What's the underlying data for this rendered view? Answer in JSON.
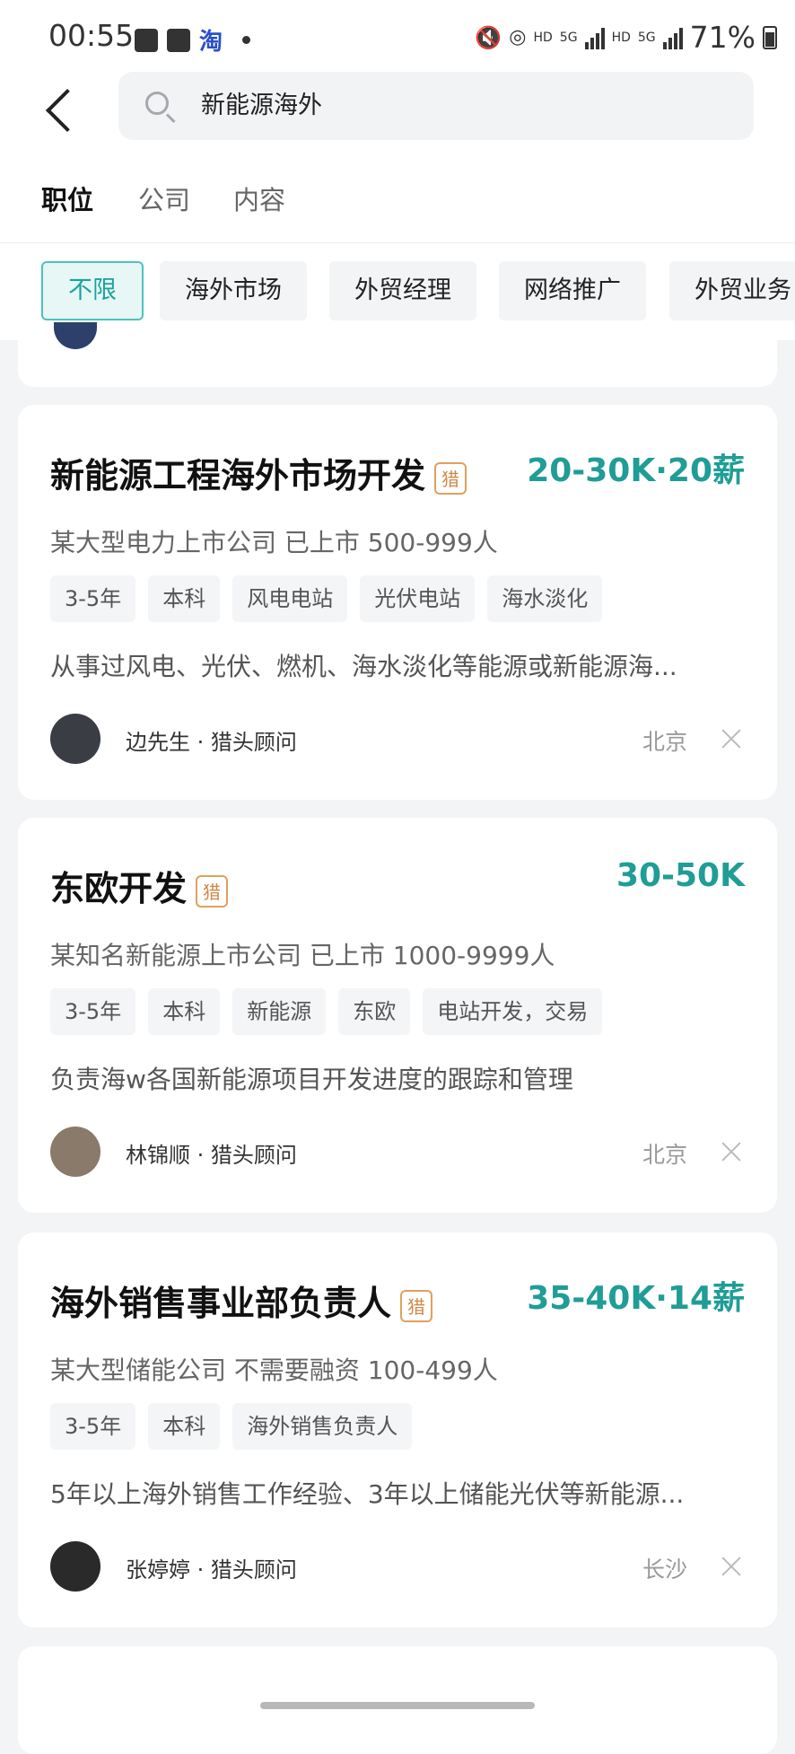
{
  "status_bar": {
    "time": "00:55",
    "left_icons": [
      "image-icon",
      "contacts-icon",
      "taobao-icon"
    ],
    "taobao_label": "淘",
    "hd1": "HD",
    "net1": "5G",
    "hd2": "HD",
    "net2": "5G",
    "battery": "71%"
  },
  "search": {
    "query": "新能源海外",
    "icon": "search-icon"
  },
  "tabs": [
    {
      "label": "职位",
      "active": true
    },
    {
      "label": "公司",
      "active": false
    },
    {
      "label": "内容",
      "active": false
    }
  ],
  "filters": [
    {
      "label": "不限",
      "active": true
    },
    {
      "label": "海外市场",
      "active": false
    },
    {
      "label": "外贸经理",
      "active": false
    },
    {
      "label": "网络推广",
      "active": false
    },
    {
      "label": "外贸业务",
      "active": false
    }
  ],
  "hunter_badge_label": "猎",
  "jobs": [
    {
      "title": "新能源工程海外市场开发",
      "salary": "20-30K·20薪",
      "company": "某大型电力上市公司  已上市  500-999人",
      "tags": [
        "3-5年",
        "本科",
        "风电电站",
        "光伏电站",
        "海水淡化"
      ],
      "description": "从事过风电、光伏、燃机、海水淡化等能源或新能源海...",
      "recruiter": "边先生 · 猎头顾问",
      "city": "北京",
      "avatar_color": "#3a3d44"
    },
    {
      "title": "东欧开发",
      "salary": "30-50K",
      "company": "某知名新能源上市公司  已上市  1000-9999人",
      "tags": [
        "3-5年",
        "本科",
        "新能源",
        "东欧",
        "电站开发，交易"
      ],
      "description": "负责海w各国新能源项目开发进度的跟踪和管理",
      "recruiter": "林锦顺 · 猎头顾问",
      "city": "北京",
      "avatar_color": "#8a7a6a"
    },
    {
      "title": "海外销售事业部负责人",
      "salary": "35-40K·14薪",
      "company": "某大型储能公司  不需要融资  100-499人",
      "tags": [
        "3-5年",
        "本科",
        "海外销售负责人"
      ],
      "description": "5年以上海外销售工作经验、3年以上储能光伏等新能源...",
      "recruiter": "张婷婷 · 猎头顾问",
      "city": "长沙",
      "avatar_color": "#2a2a2a"
    }
  ]
}
